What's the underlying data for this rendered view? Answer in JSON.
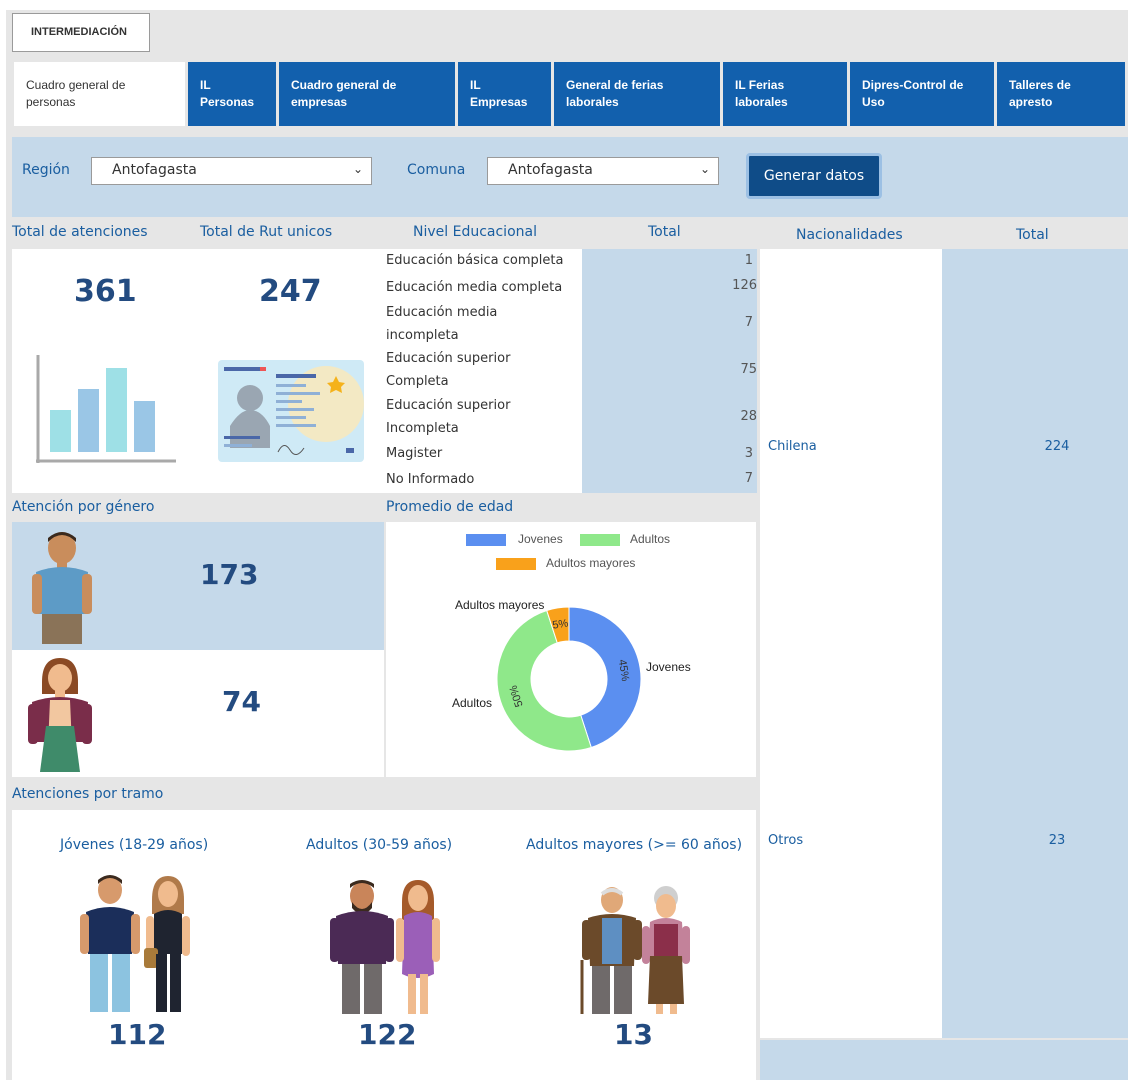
{
  "top_tab": "INTERMEDIACIÓN",
  "tabs": [
    {
      "line1": "Cuadro general de",
      "line2": "personas",
      "active": true
    },
    {
      "line1": "IL",
      "line2": "Personas"
    },
    {
      "line1": "Cuadro general de",
      "line2": "empresas"
    },
    {
      "line1": "IL",
      "line2": "Empresas"
    },
    {
      "line1": "General de ferias",
      "line2": "laborales"
    },
    {
      "line1": "IL Ferias",
      "line2": "laborales"
    },
    {
      "line1": "Dipres-Control de",
      "line2": "Uso"
    },
    {
      "line1": "Talleres de",
      "line2": "apresto"
    }
  ],
  "filters": {
    "region_label": "Región",
    "region_value": "Antofagasta",
    "comuna_label": "Comuna",
    "comuna_value": "Antofagasta",
    "button": "Generar datos"
  },
  "summary": {
    "total_atenciones_label": "Total de atenciones",
    "total_atenciones": "361",
    "total_rut_label": "Total de Rut unicos",
    "total_rut": "247"
  },
  "education": {
    "header": "Nivel Educacional",
    "total_header": "Total",
    "rows": [
      {
        "l1": "Educación básica completa",
        "l2": "",
        "value": "1"
      },
      {
        "l1": "Educación media completa",
        "l2": "",
        "value": "126"
      },
      {
        "l1": "Educación media",
        "l2": "incompleta",
        "value": "7"
      },
      {
        "l1": "Educación superior",
        "l2": "Completa",
        "value": "75"
      },
      {
        "l1": "Educación superior",
        "l2": "Incompleta",
        "value": "28"
      },
      {
        "l1": "Magister",
        "l2": "",
        "value": "3"
      },
      {
        "l1": "No Informado",
        "l2": "",
        "value": "7"
      }
    ]
  },
  "nationalities": {
    "header": "Nacionalidades",
    "total_header": "Total",
    "rows": [
      {
        "name": "Chilena",
        "value": "224"
      },
      {
        "name": "Otros",
        "value": "23"
      }
    ]
  },
  "gender": {
    "header": "Atención por género",
    "male": "173",
    "female": "74"
  },
  "age": {
    "header": "Promedio de edad",
    "legend": [
      "Jovenes",
      "Adultos",
      "Adultos mayores"
    ],
    "colors": [
      "#5b8ff0",
      "#8fe88a",
      "#f9a11b"
    ]
  },
  "chart_data": {
    "type": "pie",
    "title": "",
    "categories": [
      "Jovenes",
      "Adultos",
      "Adultos mayores"
    ],
    "values": [
      45,
      50,
      5
    ],
    "value_labels": [
      "45%",
      "50%",
      "5%"
    ],
    "legend": "top"
  },
  "tramo": {
    "header": "Atenciones por tramo",
    "groups": [
      {
        "label": "Jóvenes (18-29 años)",
        "value": "112"
      },
      {
        "label": "Adultos (30-59 años)",
        "value": "122"
      },
      {
        "label": "Adultos mayores (>= 60 años)",
        "value": "13"
      }
    ]
  }
}
